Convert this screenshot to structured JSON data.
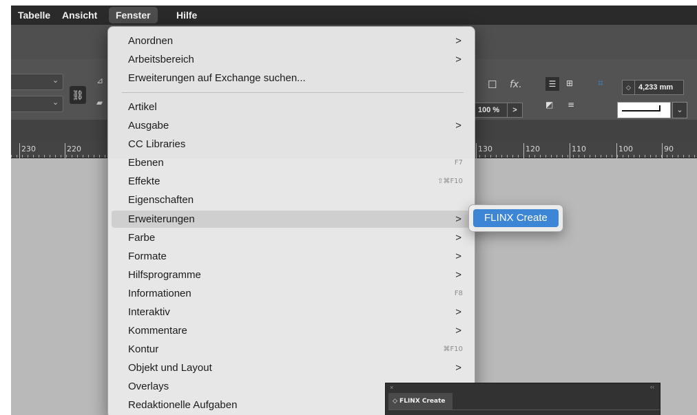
{
  "menubar": {
    "items": [
      {
        "label": "Tabelle"
      },
      {
        "label": "Ansicht"
      },
      {
        "label": "Fenster"
      },
      {
        "label": "Hilfe"
      }
    ]
  },
  "controls": {
    "link_icon": "chain-link-icon",
    "fx_label": "fx.",
    "percent_value": "100 %",
    "percent_arrow": ">",
    "stroke_weight": "4,233 mm",
    "stroke_dropdown_arrow": "⌄"
  },
  "ruler": {
    "labels": [
      "230",
      "220",
      "130",
      "120",
      "110",
      "100",
      "90"
    ]
  },
  "menu": {
    "items": [
      {
        "label": "Anordnen",
        "arrow": ">"
      },
      {
        "label": "Arbeitsbereich",
        "arrow": ">"
      },
      {
        "label": "Erweiterungen auf Exchange suchen..."
      },
      {
        "label": "Artikel"
      },
      {
        "label": "Ausgabe",
        "arrow": ">"
      },
      {
        "label": "CC Libraries"
      },
      {
        "label": "Ebenen",
        "shortcut": "F7"
      },
      {
        "label": "Effekte",
        "shortcut": "⇧⌘F10"
      },
      {
        "label": "Eigenschaften"
      },
      {
        "label": "Erweiterungen",
        "arrow": ">"
      },
      {
        "label": "Farbe",
        "arrow": ">"
      },
      {
        "label": "Formate",
        "arrow": ">"
      },
      {
        "label": "Hilfsprogramme",
        "arrow": ">"
      },
      {
        "label": "Informationen",
        "shortcut": "F8"
      },
      {
        "label": "Interaktiv",
        "arrow": ">"
      },
      {
        "label": "Kommentare",
        "arrow": ">"
      },
      {
        "label": "Kontur",
        "shortcut": "⌘F10"
      },
      {
        "label": "Objekt und Layout",
        "arrow": ">"
      },
      {
        "label": "Overlays"
      },
      {
        "label": "Redaktionelle Aufgaben"
      }
    ]
  },
  "submenu": {
    "item": "FLINX Create"
  },
  "panel": {
    "close": "×",
    "collapse": "‹‹",
    "tab_label": "◇ FLINX Create"
  }
}
